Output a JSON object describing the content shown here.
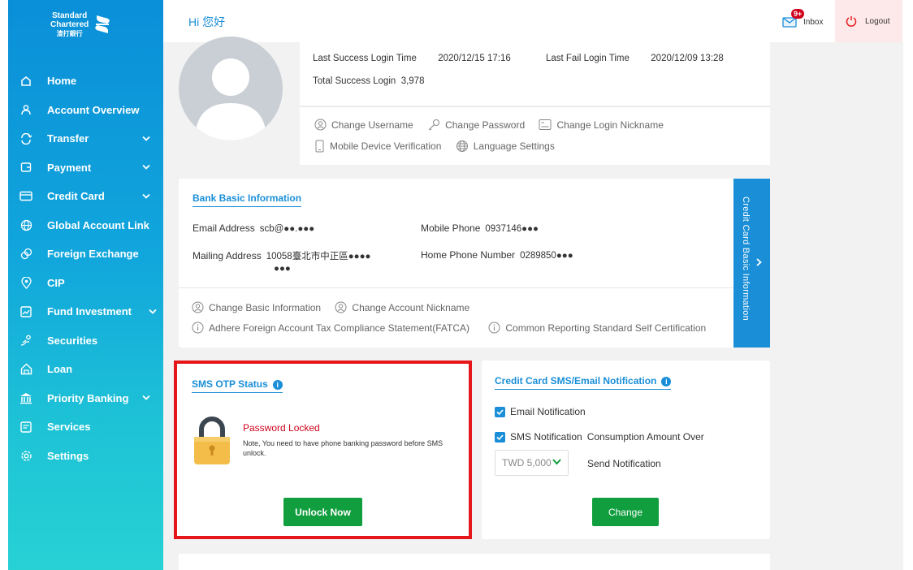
{
  "brand": {
    "line1": "Standard",
    "line2": "Chartered",
    "line3": "渣打銀行"
  },
  "sidebar": {
    "items": [
      {
        "label": "Home",
        "icon": "home-icon"
      },
      {
        "label": "Account Overview",
        "icon": "person-icon"
      },
      {
        "label": "Transfer",
        "icon": "transfer-icon",
        "expandable": true
      },
      {
        "label": "Payment",
        "icon": "wallet-icon",
        "expandable": true
      },
      {
        "label": "Credit Card",
        "icon": "credit-card-icon",
        "expandable": true
      },
      {
        "label": "Global Account Link",
        "icon": "globe-icon"
      },
      {
        "label": "Foreign Exchange",
        "icon": "exchange-icon"
      },
      {
        "label": "CIP",
        "icon": "pin-icon"
      },
      {
        "label": "Fund Investment",
        "icon": "chart-icon",
        "expandable": true
      },
      {
        "label": "Securities",
        "icon": "securities-icon"
      },
      {
        "label": "Loan",
        "icon": "house-icon"
      },
      {
        "label": "Priority Banking",
        "icon": "bank-icon",
        "expandable": true
      },
      {
        "label": "Services",
        "icon": "services-icon"
      },
      {
        "label": "Settings",
        "icon": "gear-icon"
      }
    ]
  },
  "header": {
    "greeting": "Hi 您好",
    "inbox_label": "Inbox",
    "inbox_badge": "9+",
    "logout_label": "Logout"
  },
  "login": {
    "last_success_label": "Last Success Login Time",
    "last_success_value": "2020/12/15 17:16",
    "last_fail_label": "Last Fail Login Time",
    "last_fail_value": "2020/12/09 13:28",
    "total_label": "Total Success Login",
    "total_value": "3,978",
    "actions": {
      "change_username": "Change Username",
      "change_password": "Change Password",
      "change_nickname": "Change Login Nickname",
      "mobile_verification": "Mobile Device Verification",
      "language_settings": "Language Settings"
    }
  },
  "bank_info": {
    "title": "Bank Basic Information",
    "email_label": "Email Address",
    "email_value": "scb@●●.●●●",
    "mobile_label": "Mobile Phone",
    "mobile_value": "0937146●●●",
    "mailing_label": "Mailing Address",
    "mailing_value_1": "10058臺北市中正區●●●●",
    "mailing_value_2": "●●●",
    "home_phone_label": "Home Phone Number",
    "home_phone_value": "0289850●●●",
    "actions": {
      "change_basic_info": "Change Basic Information",
      "change_account_nickname": "Change Account Nickname",
      "fatca": "Adhere Foreign Account Tax Compliance Statement(FATCA)",
      "crs": "Common Reporting Standard Self Certification"
    },
    "side_tab": "Credit Card Basic Information"
  },
  "sms_otp": {
    "title": "SMS OTP Status",
    "status": "Password Locked",
    "note": "Note, You need to have phone banking password before SMS unlock.",
    "button": "Unlock Now"
  },
  "notification": {
    "title": "Credit Card SMS/Email Notification",
    "email_label": "Email Notification",
    "email_checked": true,
    "sms_label": "SMS Notification",
    "sms_checked": true,
    "consumption_label": "Consumption Amount Over",
    "amount_selected": "TWD 5,000",
    "send_label": "Send Notification",
    "button": "Change"
  },
  "colors": {
    "accent": "#1a8fd8",
    "green": "#109e3e",
    "alert_red": "#d0021b",
    "highlight_border": "#e6171b"
  }
}
